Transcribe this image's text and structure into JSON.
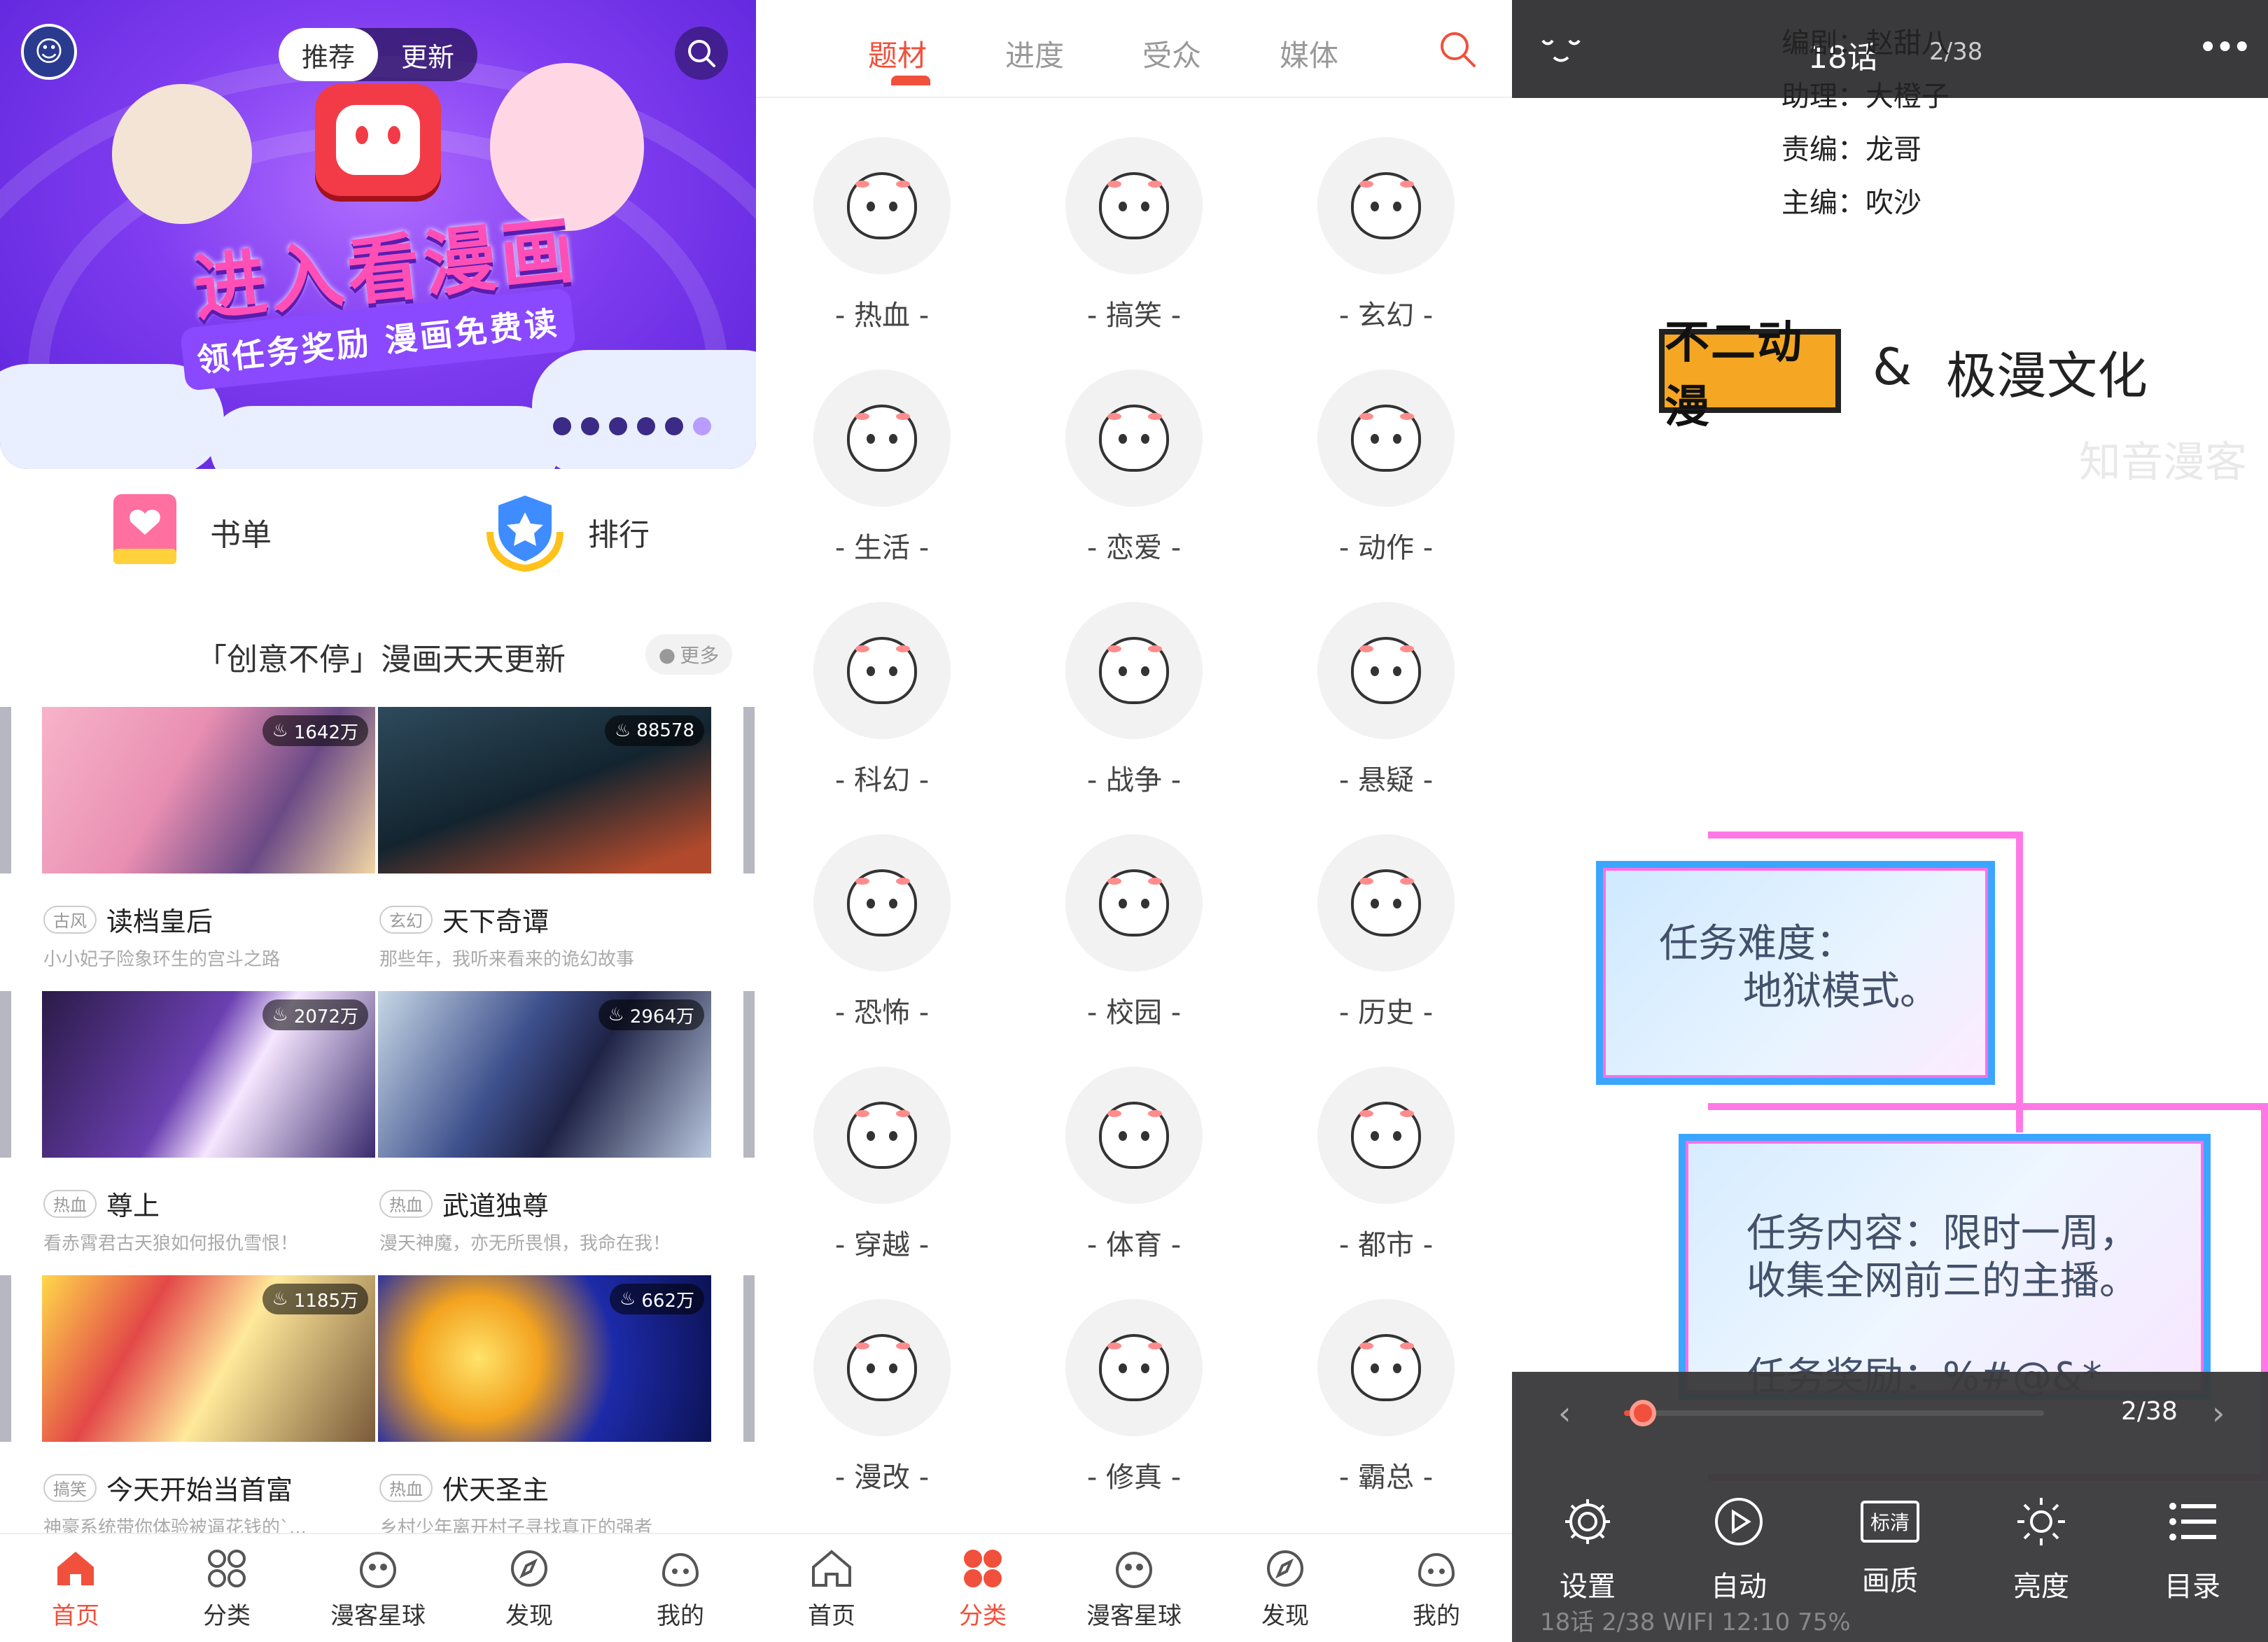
{
  "screen1": {
    "segment": {
      "left": "推荐",
      "right": "更新"
    },
    "banner": {
      "title": "进入看漫画",
      "ribbon": "领任务奖励 漫画免费读"
    },
    "quick": [
      {
        "label": "书单"
      },
      {
        "label": "排行"
      }
    ],
    "section": {
      "title": "「创意不停」漫画天天更新",
      "more": "更多"
    },
    "cards": [
      {
        "views": "1642万",
        "tag": "古风",
        "title": "读档皇后",
        "desc": "小小妃子险象环生的宫斗之路"
      },
      {
        "views": "88578",
        "tag": "玄幻",
        "title": "天下奇谭",
        "desc": "那些年，我听来看来的诡幻故事"
      },
      {
        "views": "2072万",
        "tag": "热血",
        "title": "尊上",
        "desc": "看赤霄君古天狼如何报仇雪恨！"
      },
      {
        "views": "2964万",
        "tag": "热血",
        "title": "武道独尊",
        "desc": "漫天神魔，亦无所畏惧，我命在我！"
      },
      {
        "views": "1185万",
        "tag": "搞笑",
        "title": "今天开始当首富",
        "desc": "神豪系统带你体验被逼花钱的`..."
      },
      {
        "views": "662万",
        "tag": "热血",
        "title": "伏天圣主",
        "desc": "乡村少年离开村子寻找真正的强者"
      }
    ],
    "tabbar": [
      {
        "label": "首页"
      },
      {
        "label": "分类"
      },
      {
        "label": "漫客星球"
      },
      {
        "label": "发现"
      },
      {
        "label": "我的"
      }
    ]
  },
  "screen2": {
    "tabs": [
      {
        "label": "题材"
      },
      {
        "label": "进度"
      },
      {
        "label": "受众"
      },
      {
        "label": "媒体"
      }
    ],
    "categories": [
      {
        "label": "- 热血 -"
      },
      {
        "label": "- 搞笑 -"
      },
      {
        "label": "- 玄幻 -"
      },
      {
        "label": "- 生活 -"
      },
      {
        "label": "- 恋爱 -"
      },
      {
        "label": "- 动作 -"
      },
      {
        "label": "- 科幻 -"
      },
      {
        "label": "- 战争 -"
      },
      {
        "label": "- 悬疑 -"
      },
      {
        "label": "- 恐怖 -"
      },
      {
        "label": "- 校园 -"
      },
      {
        "label": "- 历史 -"
      },
      {
        "label": "- 穿越 -"
      },
      {
        "label": "- 体育 -"
      },
      {
        "label": "- 都市 -"
      },
      {
        "label": "- 漫改 -"
      },
      {
        "label": "- 修真 -"
      },
      {
        "label": "- 霸总 -"
      }
    ],
    "tabbar": [
      {
        "label": "首页"
      },
      {
        "label": "分类"
      },
      {
        "label": "漫客星球"
      },
      {
        "label": "发现"
      },
      {
        "label": "我的"
      }
    ]
  },
  "screen3": {
    "chapter": "18话",
    "page": "2/38",
    "credits": [
      "编剧：赵甜八",
      "助理：大橙子",
      "责编：龙哥",
      "主编：吹沙"
    ],
    "logo1": "不二动漫",
    "logo2": "极漫文化",
    "watermark": "知音漫客",
    "panel1": [
      "任务难度：",
      "地狱模式。"
    ],
    "panel2": [
      "任务内容：限时一周，",
      "收集全网前三的主播。",
      "任务奖励：%#@&*"
    ],
    "slider": {
      "page": "2/38",
      "progress": 0.03
    },
    "tools": [
      {
        "label": "设置"
      },
      {
        "label": "自动"
      },
      {
        "label": "画质",
        "badge": "标清"
      },
      {
        "label": "亮度"
      },
      {
        "label": "目录"
      }
    ],
    "statusbar": "18话  2/38  WIFI  12:10  75%"
  },
  "colors": {
    "accent": "#f0503c",
    "bannerPurple": "#7f3cf0",
    "readerBar": "#3a3a3c"
  }
}
